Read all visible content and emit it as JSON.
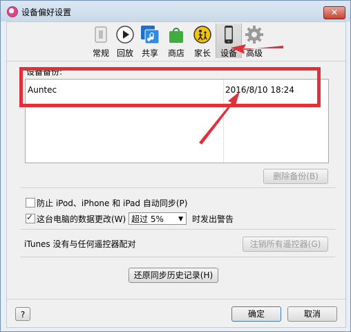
{
  "window": {
    "title": "设备偏好设置",
    "close_label": "✕"
  },
  "toolbar": {
    "items": [
      {
        "label": "常规",
        "icon": "switch-icon"
      },
      {
        "label": "回放",
        "icon": "play-icon"
      },
      {
        "label": "共享",
        "icon": "music-share-icon"
      },
      {
        "label": "商店",
        "icon": "shopping-bag-icon"
      },
      {
        "label": "家长",
        "icon": "parental-icon"
      },
      {
        "label": "设备",
        "icon": "iphone-icon",
        "selected": true
      },
      {
        "label": "高级",
        "icon": "gear-icon"
      }
    ]
  },
  "backups": {
    "group_label": "设备备份:",
    "rows": [
      {
        "name": "Auntec",
        "date": "2016/8/10 18:24"
      }
    ],
    "delete_label": "删除备份(B)"
  },
  "sync": {
    "prevent_auto_sync_label": "防止 iPod、iPhone 和 iPad 自动同步(P)",
    "prevent_auto_sync_checked": false,
    "warn_data_change_label": "这台电脑的数据更改(W)",
    "warn_data_change_checked": true,
    "threshold_value": "超过 5%",
    "warn_suffix": "时发出警告"
  },
  "remotes": {
    "text": "iTunes 没有与任何遥控器配对",
    "unpair_label": "注销所有遥控器(G)"
  },
  "reset_history_label": "还原同步历史记录(H)",
  "footer": {
    "help_label": "?",
    "ok_label": "确定",
    "cancel_label": "取消"
  },
  "colors": {
    "annotation_red": "#e0313a",
    "accent": "#3c7fb1"
  }
}
